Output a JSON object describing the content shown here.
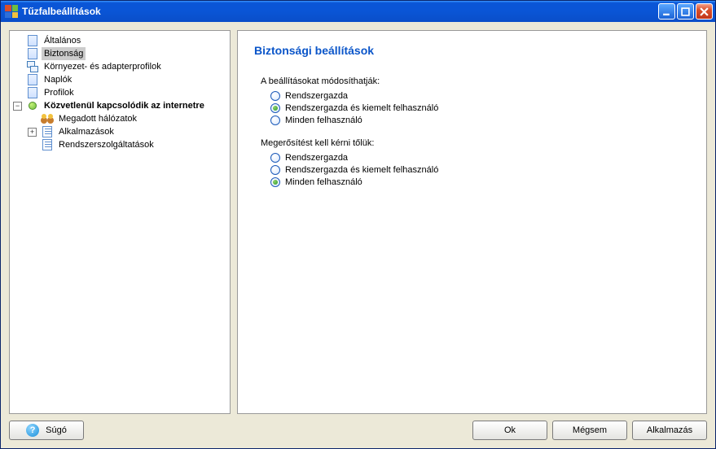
{
  "window": {
    "title": "Tűzfalbeállítások"
  },
  "tree": {
    "items": {
      "general": "Általános",
      "security": "Biztonság",
      "env": "Környezet- és adapterprofilok",
      "logs": "Naplók",
      "profiles": "Profilok",
      "direct": "Közvetlenül kapcsolódik az internetre",
      "networks": "Megadott hálózatok",
      "apps": "Alkalmazások",
      "services": "Rendszerszolgáltatások"
    }
  },
  "main": {
    "title": "Biztonsági beállítások",
    "group1": {
      "label": "A beállításokat módosíthatják:",
      "options": {
        "admin": "Rendszergazda",
        "admin_power": "Rendszergazda és kiemelt felhasználó",
        "all": "Minden felhasználó"
      },
      "selected": "admin_power"
    },
    "group2": {
      "label": "Megerősítést kell kérni tőlük:",
      "options": {
        "admin": "Rendszergazda",
        "admin_power": "Rendszergazda és kiemelt felhasználó",
        "all": "Minden felhasználó"
      },
      "selected": "all"
    }
  },
  "buttons": {
    "help": "Súgó",
    "ok": "Ok",
    "cancel": "Mégsem",
    "apply": "Alkalmazás"
  }
}
